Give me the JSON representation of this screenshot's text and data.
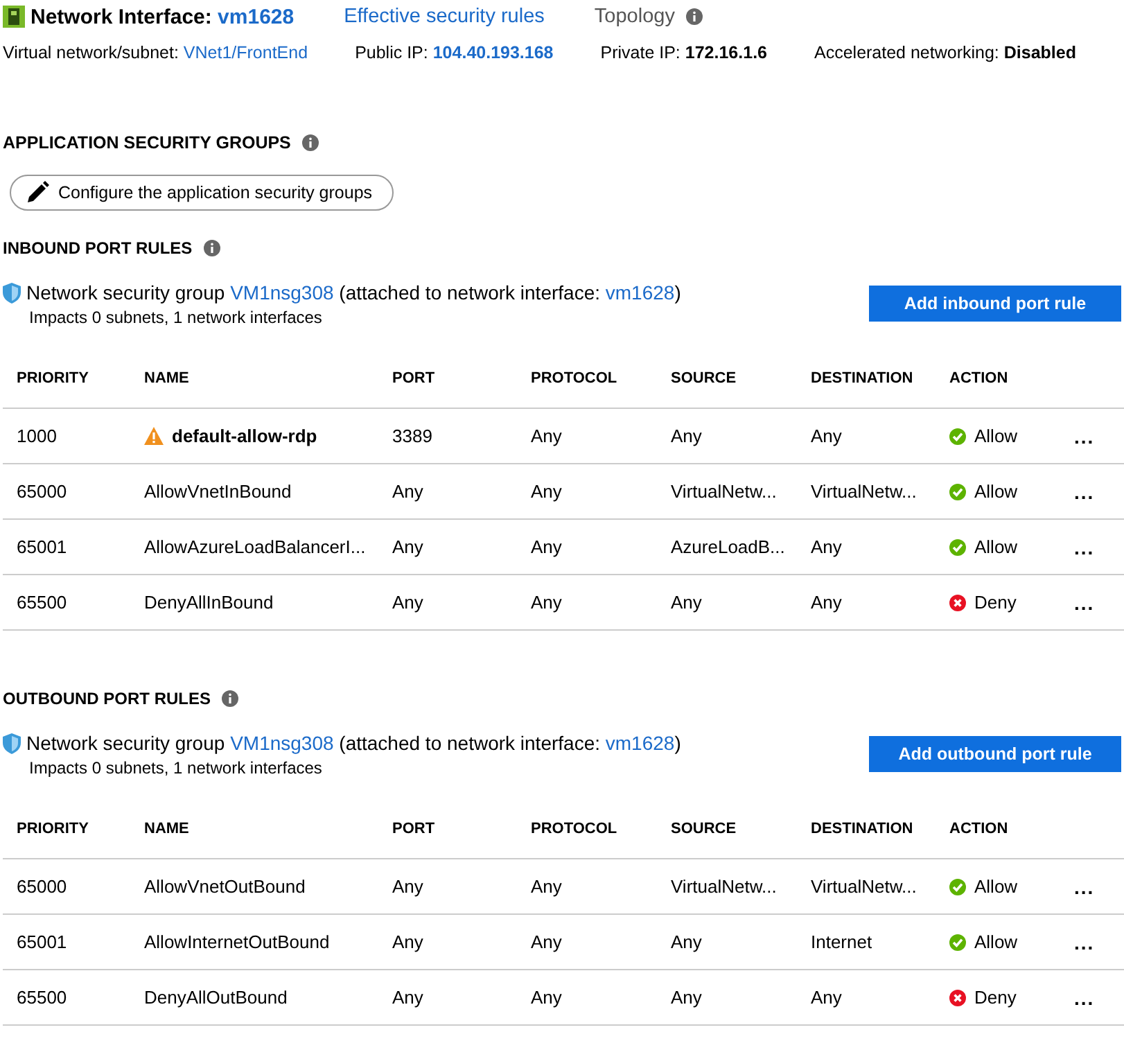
{
  "header": {
    "title_label": "Network Interface:",
    "title_value": "vm1628",
    "links": [
      "Effective security rules"
    ],
    "topology": "Topology"
  },
  "properties": [
    {
      "label": "Virtual network/subnet:",
      "value": "VNet1/FrontEnd",
      "kind": "link"
    },
    {
      "label": "Public IP:",
      "value": "104.40.193.168",
      "kind": "boldlink"
    },
    {
      "label": "Private IP:",
      "value": "172.16.1.6",
      "kind": "bold"
    },
    {
      "label": "Accelerated networking:",
      "value": "Disabled",
      "kind": "bold"
    }
  ],
  "asg": {
    "heading": "APPLICATION SECURITY GROUPS",
    "button": "Configure the application security groups"
  },
  "rule_sections": [
    {
      "heading": "INBOUND PORT RULES",
      "nsg_prefix": "Network security group",
      "nsg_name": "VM1nsg308",
      "nsg_middle": "(attached to network interface:",
      "nsg_nic": "vm1628",
      "nsg_suffix": ")",
      "impacts": "Impacts 0 subnets, 1 network interfaces",
      "button": "Add inbound port rule",
      "columns": [
        "PRIORITY",
        "NAME",
        "PORT",
        "PROTOCOL",
        "SOURCE",
        "DESTINATION",
        "ACTION"
      ],
      "rows": [
        {
          "priority": "1000",
          "name": "default-allow-rdp",
          "warning": true,
          "port": "3389",
          "protocol": "Any",
          "source": "Any",
          "destination": "Any",
          "action": "Allow",
          "kind": "allow",
          "more": "..."
        },
        {
          "priority": "65000",
          "name": "AllowVnetInBound",
          "warning": false,
          "port": "Any",
          "protocol": "Any",
          "source": "VirtualNetw...",
          "destination": "VirtualNetw...",
          "action": "Allow",
          "kind": "allow",
          "more": "..."
        },
        {
          "priority": "65001",
          "name": "AllowAzureLoadBalancerI...",
          "warning": false,
          "port": "Any",
          "protocol": "Any",
          "source": "AzureLoadB...",
          "destination": "Any",
          "action": "Allow",
          "kind": "allow",
          "more": "..."
        },
        {
          "priority": "65500",
          "name": "DenyAllInBound",
          "warning": false,
          "port": "Any",
          "protocol": "Any",
          "source": "Any",
          "destination": "Any",
          "action": "Deny",
          "kind": "deny",
          "more": "..."
        }
      ]
    },
    {
      "heading": "OUTBOUND PORT RULES",
      "nsg_prefix": "Network security group",
      "nsg_name": "VM1nsg308",
      "nsg_middle": "(attached to network interface:",
      "nsg_nic": "vm1628",
      "nsg_suffix": ")",
      "impacts": "Impacts 0 subnets, 1 network interfaces",
      "button": "Add outbound port rule",
      "columns": [
        "PRIORITY",
        "NAME",
        "PORT",
        "PROTOCOL",
        "SOURCE",
        "DESTINATION",
        "ACTION"
      ],
      "rows": [
        {
          "priority": "65000",
          "name": "AllowVnetOutBound",
          "warning": false,
          "port": "Any",
          "protocol": "Any",
          "source": "VirtualNetw...",
          "destination": "VirtualNetw...",
          "action": "Allow",
          "kind": "allow",
          "more": "..."
        },
        {
          "priority": "65001",
          "name": "AllowInternetOutBound",
          "warning": false,
          "port": "Any",
          "protocol": "Any",
          "source": "Any",
          "destination": "Internet",
          "action": "Allow",
          "kind": "allow",
          "more": "..."
        },
        {
          "priority": "65500",
          "name": "DenyAllOutBound",
          "warning": false,
          "port": "Any",
          "protocol": "Any",
          "source": "Any",
          "destination": "Any",
          "action": "Deny",
          "kind": "deny",
          "more": "..."
        }
      ]
    }
  ]
}
